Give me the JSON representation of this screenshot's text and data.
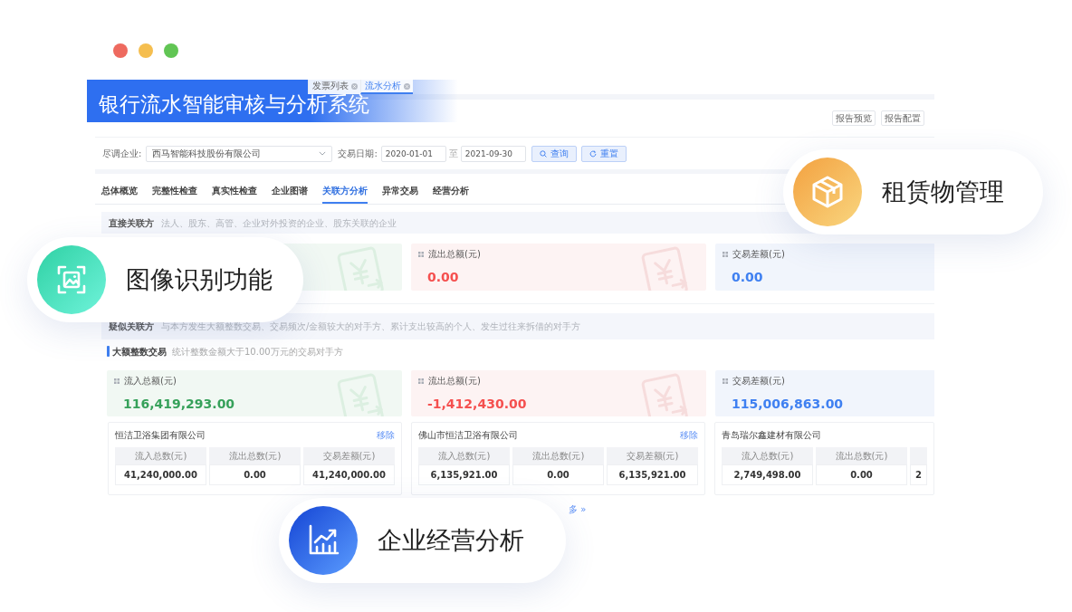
{
  "window": {
    "controls": [
      {
        "color": "#ee6a5f"
      },
      {
        "color": "#f5be4f"
      },
      {
        "color": "#61c554"
      }
    ]
  },
  "banner": {
    "title": "银行流水智能审核与分析系统"
  },
  "app_tabs": [
    {
      "label": "发票列表",
      "selected": false
    },
    {
      "label": "流水分析",
      "selected": true
    }
  ],
  "header_buttons": [
    "报告预览",
    "报告配置"
  ],
  "filters": {
    "company_label": "尽调企业:",
    "company": "西马智能科技股份有限公司",
    "date_label": "交易日期:",
    "date_from": "2020-01-01",
    "date_separator": "至",
    "date_to": "2021-09-30",
    "buttons": [
      {
        "kind": "search",
        "label": "查询"
      },
      {
        "kind": "reset",
        "label": "重置"
      }
    ]
  },
  "analysis_tabs": [
    {
      "label": "总体概览",
      "selected": false
    },
    {
      "label": "完整性检查",
      "selected": false
    },
    {
      "label": "真实性检查",
      "selected": false
    },
    {
      "label": "企业图谱",
      "selected": false
    },
    {
      "label": "关联方分析",
      "selected": true
    },
    {
      "label": "异常交易",
      "selected": false
    },
    {
      "label": "经营分析",
      "selected": false
    }
  ],
  "direct_related": {
    "title": "直接关联方",
    "description": "法人、股东、高管、企业对外投资的企业、股东关联的企业",
    "stats": [
      {
        "kind": "inflow"
      },
      {
        "kind": "outflow",
        "label": "流出总额(元)",
        "value": "0.00"
      },
      {
        "kind": "balance",
        "label": "交易差额(元)",
        "value": "0.00"
      }
    ]
  },
  "suspected_related": {
    "title": "疑似关联方",
    "description": "与本方发生大额整数交易、交易频次/金额较大的对手方、累计支出较高的个人、发生过往来拆借的对手方"
  },
  "large_round_transactions": {
    "title": "大额整数交易",
    "description": "统计整数金额大于10.00万元的交易对手方",
    "stats": [
      {
        "kind": "inflow",
        "label": "流入总额(元)",
        "value": "116,419,293.00"
      },
      {
        "kind": "outflow",
        "label": "流出总额(元)",
        "value": "-1,412,430.00"
      },
      {
        "kind": "balance",
        "label": "交易差额(元)",
        "value": "115,006,863.00"
      }
    ],
    "counterparties": [
      {
        "name": "恒洁卫浴集团有限公司",
        "action": "移除",
        "columns": [
          {
            "header": "流入总数(元)",
            "value": "41,240,000.00"
          },
          {
            "header": "流出总数(元)",
            "value": "0.00"
          },
          {
            "header": "交易差额(元)",
            "value": "41,240,000.00"
          }
        ]
      },
      {
        "name": "佛山市恒洁卫浴有限公司",
        "action": "移除",
        "columns": [
          {
            "header": "流入总数(元)",
            "value": "6,135,921.00"
          },
          {
            "header": "流出总数(元)",
            "value": "0.00"
          },
          {
            "header": "交易差额(元)",
            "value": "6,135,921.00"
          }
        ]
      },
      {
        "name": "青岛瑞尔鑫建材有限公司",
        "columns": [
          {
            "header": "流入总数(元)",
            "value": "2,749,498.00"
          },
          {
            "header": "流出总数(元)",
            "value": "0.00"
          },
          {
            "value": "2"
          }
        ]
      }
    ],
    "more_link": "多 »"
  },
  "feature_badges": [
    {
      "kind": "lease",
      "label": "租赁物管理"
    },
    {
      "kind": "image",
      "label": "图像识别功能"
    },
    {
      "kind": "business",
      "label": "企业经营分析"
    }
  ]
}
